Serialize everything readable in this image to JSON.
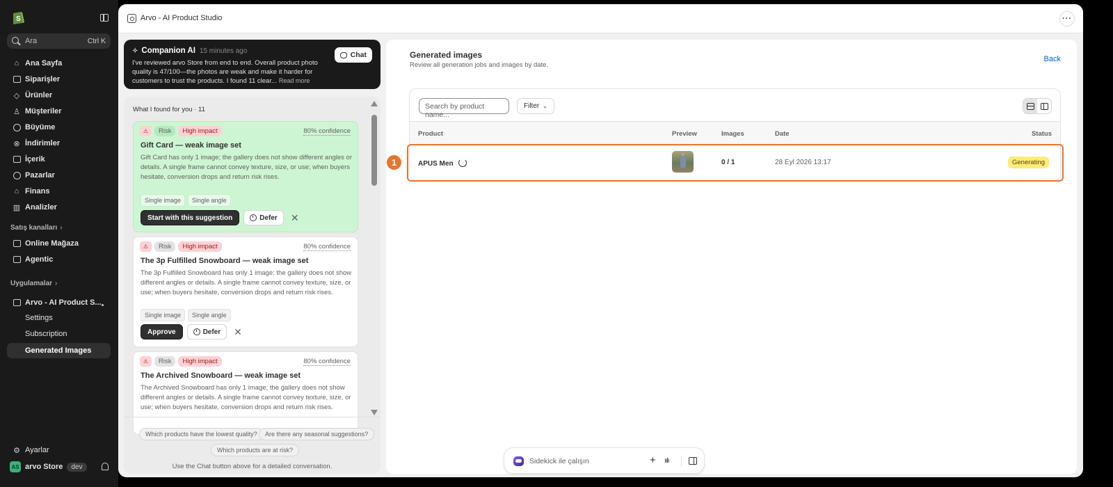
{
  "sidebar": {
    "search": {
      "placeholder": "Ara",
      "shortcut": "Ctrl K"
    },
    "nav": [
      {
        "label": "Ana Sayfa",
        "icon": "home-icon"
      },
      {
        "label": "Siparişler",
        "icon": "inbox-icon"
      },
      {
        "label": "Ürünler",
        "icon": "tag-icon"
      },
      {
        "label": "Müşteriler",
        "icon": "person-icon"
      },
      {
        "label": "Büyüme",
        "icon": "gauge-icon"
      },
      {
        "label": "İndirimler",
        "icon": "discount-icon"
      },
      {
        "label": "İçerik",
        "icon": "content-icon"
      },
      {
        "label": "Pazarlar",
        "icon": "globe-icon"
      },
      {
        "label": "Finans",
        "icon": "bank-icon"
      },
      {
        "label": "Analizler",
        "icon": "bar-chart-icon"
      }
    ],
    "sales_channels": {
      "title": "Satış kanalları",
      "items": [
        {
          "label": "Online Mağaza",
          "icon": "store-icon"
        },
        {
          "label": "Agentic",
          "icon": "agentic-icon"
        }
      ]
    },
    "apps": {
      "title": "Uygulamalar",
      "app_name": "Arvo - AI Product S...",
      "subitems": [
        "Settings",
        "Subscription",
        "Generated Images"
      ]
    },
    "settings_label": "Ayarlar",
    "store": {
      "name": "arvo Store",
      "badge": "dev",
      "avatar_text": "AS"
    }
  },
  "window": {
    "title": "Arvo - AI Product Studio",
    "more": "···"
  },
  "companion": {
    "title": "Companion AI",
    "time_ago": "15 minutes ago",
    "body": "I've reviewed arvo Store from end to end. Overall product photo quality is 47/100—the photos are weak and make it harder for customers to trust the products. I found 11 clear...",
    "read_more": "Read more",
    "chat_label": "Chat"
  },
  "findings": {
    "title": "What I found for you · 11",
    "items": [
      {
        "risk": "Risk",
        "impact": "High impact",
        "confidence": "80% confidence",
        "title": "Gift Card — weak image set",
        "body": "Gift Card has only 1 image; the gallery does not show different angles or details. A single frame cannot convey texture, size, or use; when buyers hesitate, conversion drops and return risk rises.",
        "chips": [
          "Single image",
          "Single angle"
        ],
        "primary": "Start with this suggestion",
        "defer": "Defer"
      },
      {
        "risk": "Risk",
        "impact": "High impact",
        "confidence": "80% confidence",
        "title": "The 3p Fulfilled Snowboard — weak image set",
        "body": "The 3p Fulfilled Snowboard has only 1 image; the gallery does not show different angles or details. A single frame cannot convey texture, size, or use; when buyers hesitate, conversion drops and return risk rises.",
        "chips": [
          "Single image",
          "Single angle"
        ],
        "primary": "Approve",
        "defer": "Defer"
      },
      {
        "risk": "Risk",
        "impact": "High impact",
        "confidence": "80% confidence",
        "title": "The Archived Snowboard — weak image set",
        "body": "The Archived Snowboard has only 1 image; the gallery does not show different angles or details. A single frame cannot convey texture, size, or use; when buyers hesitate, conversion drops and return risk rises."
      }
    ],
    "questions": [
      "Which products have the lowest quality?",
      "Are there any seasonal suggestions?",
      "Which products are at risk?"
    ],
    "hint": "Use the Chat button above for a detailed conversation."
  },
  "generated": {
    "title": "Generated images",
    "subtitle": "Review all generation jobs and images by date.",
    "back": "Back",
    "search_placeholder": "Search by product name...",
    "filter": "Filter",
    "columns": {
      "product": "Product",
      "preview": "Preview",
      "images": "Images",
      "date": "Date",
      "status": "Status"
    },
    "rows": [
      {
        "product": "APUS Men",
        "images": "0 / 1",
        "date": "28 Eyl 2026 13:17",
        "status": "Generating"
      }
    ]
  },
  "annotation": {
    "marker": "1",
    "color": "#e8742e"
  },
  "sidekick": {
    "placeholder": "Sidekick ile çalışın"
  },
  "colors": {
    "sidebar": "#1a1a1a",
    "highlight_card": "#cdf5d3",
    "status_badge": "#ffeb78",
    "link": "#005bd3"
  }
}
